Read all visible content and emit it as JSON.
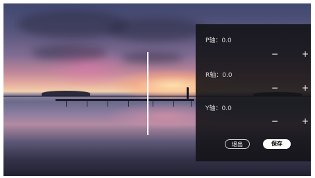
{
  "axes": [
    {
      "label": "P轴：0.0",
      "minus": "−",
      "plus": "+"
    },
    {
      "label": "R轴：0.0",
      "minus": "−",
      "plus": "+"
    },
    {
      "label": "Y轴：0.0",
      "minus": "−",
      "plus": "+"
    }
  ],
  "buttons": {
    "exit": "退出",
    "save": "保存"
  }
}
